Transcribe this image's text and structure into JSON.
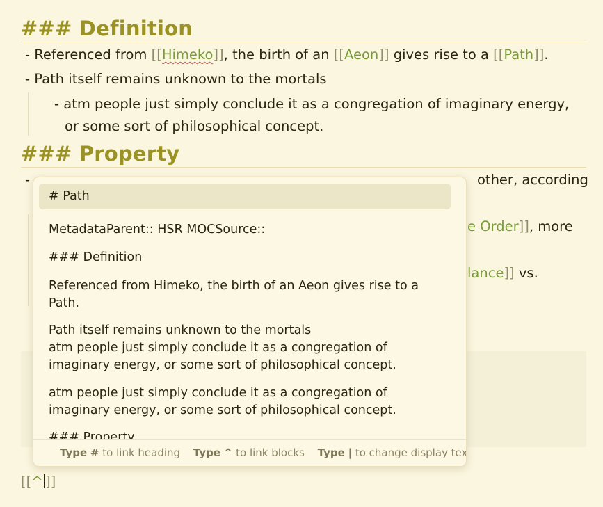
{
  "doc": {
    "definition_heading": {
      "hashes": "###",
      "text": "Definition"
    },
    "def_line1": {
      "prefix": "- Referenced from ",
      "open": "[[",
      "link1": "Himeko",
      "close": "]]",
      "mid1": ", the birth of an ",
      "link2": "Aeon",
      "mid2": " gives rise to a ",
      "link3": "Path",
      "end": "."
    },
    "def_line2": "- Path itself remains unknown to the mortals",
    "def_line3": "- atm people just simply conclude it as a congregation of imaginary energy,",
    "def_line4": "or some sort of philosophical concept.",
    "property_heading": {
      "hashes": "###",
      "text": "Property"
    },
    "prop_line1_tail": "other, according",
    "prop_line2_tail": {
      "link": "e Order",
      "close": "]]",
      "text": ", more"
    },
    "prop_line3_tail": {
      "link": "lance",
      "close": "]]",
      "text": " vs."
    },
    "prop_line1_dash": "-",
    "bottom_input": {
      "open": "[[",
      "typed": "^",
      "close": "]]"
    }
  },
  "popup": {
    "suggestions": [
      "# Path",
      "MetadataParent:: HSR MOCSource::",
      "### Definition",
      "Referenced from Himeko, the birth of an Aeon gives rise to a Path.",
      "Path itself remains unknown to the mortals\natm people just simply conclude it as a congregation of imaginary energy, or some sort of philosophical concept.",
      "atm people just simply conclude it as a congregation of imaginary energy, or some sort of philosophical concept.",
      "### Property"
    ],
    "footer": {
      "type1": "Type",
      "key1": "#",
      "hint1": "to link heading",
      "type2": "Type",
      "key2": "^",
      "hint2": "to link blocks",
      "type3": "Type",
      "key3": "|",
      "hint3": "to change display text"
    }
  }
}
